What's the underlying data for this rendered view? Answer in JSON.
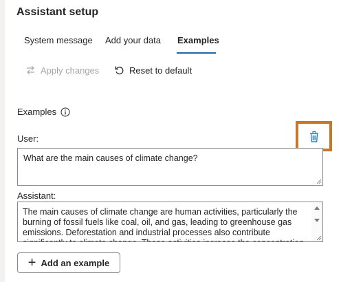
{
  "panel": {
    "title": "Assistant setup"
  },
  "tabs": [
    {
      "label": "System message",
      "active": false
    },
    {
      "label": "Add your data",
      "active": false
    },
    {
      "label": "Examples",
      "active": true
    }
  ],
  "toolbar": {
    "apply_label": "Apply changes",
    "apply_enabled": false,
    "reset_label": "Reset to default"
  },
  "examples": {
    "section_label": "Examples",
    "info_icon": "info-icon",
    "user_label": "User:",
    "user_text": "What are the main causes of climate change?",
    "delete_icon": "trash-icon",
    "assistant_label": "Assistant:",
    "assistant_text": "The main causes of climate change are human activities, particularly the burning of fossil fuels like coal, oil, and gas, leading to greenhouse gas emissions. Deforestation and industrial processes also contribute significantly to climate change. These activities increase the concentration",
    "add_label": "Add an example"
  },
  "colors": {
    "accent": "#0f6cbd",
    "highlight": "#c7772a",
    "disabled_text": "#a6a6a6"
  }
}
